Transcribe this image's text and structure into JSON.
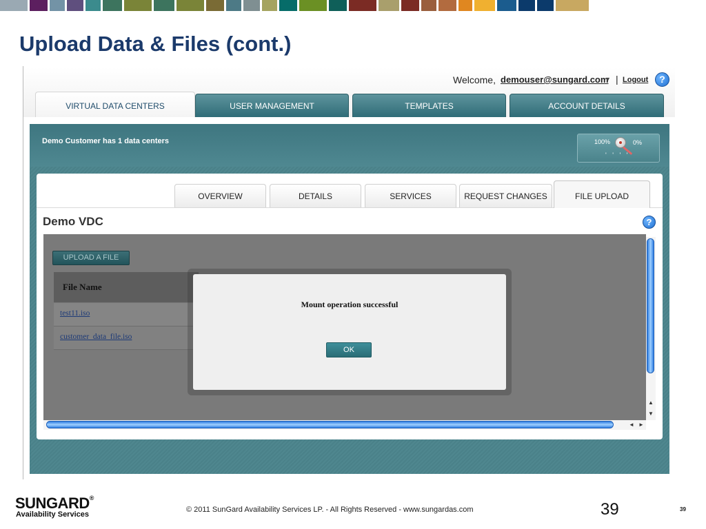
{
  "slide": {
    "title": "Upload Data & Files (cont.)",
    "strip_colors": [
      "#9aa9b3",
      "#5c1f5f",
      "#7393a6",
      "#5f4f7e",
      "#3b8b8d",
      "#3d745e",
      "#7a8438",
      "#3d745e",
      "#7a8438",
      "#7a6b35",
      "#4d7a86",
      "#7f8f92",
      "#a5a460",
      "#066c69",
      "#6b9024",
      "#0f5f59",
      "#7b2b24",
      "#a99f6c",
      "#7b2b24",
      "#9a5f3d",
      "#b26b3f",
      "#e08720",
      "#f0b030",
      "#1b5c8e",
      "#0b3a6b",
      "#0b3a6b",
      "#c8a861"
    ]
  },
  "header": {
    "welcome_label": "Welcome,",
    "user_email": "demouser@sungard.com",
    "separator": "|",
    "logout_label": "Logout",
    "help_glyph": "?"
  },
  "main_tabs": [
    {
      "label": "VIRTUAL DATA CENTERS",
      "active": true
    },
    {
      "label": "USER MANAGEMENT",
      "active": false
    },
    {
      "label": "TEMPLATES",
      "active": false
    },
    {
      "label": "ACCOUNT DETAILS",
      "active": false
    }
  ],
  "dc_summary": "Demo Customer has 1 data centers",
  "gauge": {
    "left_label": "100%",
    "right_label": "0%",
    "ticks": "' ' ' '"
  },
  "sub_tabs": [
    {
      "label": "OVERVIEW",
      "active": false
    },
    {
      "label": "DETAILS",
      "active": false
    },
    {
      "label": "SERVICES",
      "active": false
    },
    {
      "label": "REQUEST CHANGES",
      "active": false
    },
    {
      "label": "FILE UPLOAD",
      "active": true
    }
  ],
  "vdc": {
    "title": "Demo VDC",
    "help_glyph": "?",
    "upload_button": "UPLOAD A FILE",
    "table": {
      "column": "File Name",
      "rows": [
        "test11.iso",
        "customer_data_file.iso"
      ]
    }
  },
  "modal": {
    "message": "Mount operation successful",
    "ok_label": "OK"
  },
  "scrollbars": {
    "up_glyph": "▲",
    "down_glyph": "▼",
    "left_glyph": "◄",
    "right_glyph": "►"
  },
  "footer": {
    "logo_main": "SUNGARD",
    "logo_reg": "®",
    "logo_sub": "Availability Services",
    "copyright": "© 2011 SunGard Availability Services LP. - All Rights Reserved - www.sungardas.com",
    "page_number_large": "39",
    "page_number_small": "39"
  }
}
